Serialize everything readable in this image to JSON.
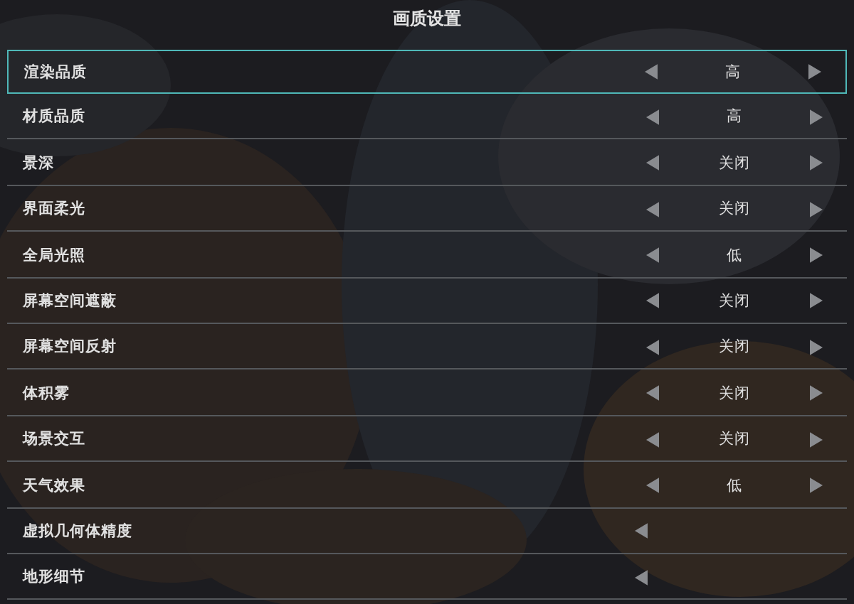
{
  "title": "画质设置",
  "settings": [
    {
      "label": "渲染品质",
      "value": "高",
      "selected": true
    },
    {
      "label": "材质品质",
      "value": "高",
      "selected": false
    },
    {
      "label": "景深",
      "value": "关闭",
      "selected": false
    },
    {
      "label": "界面柔光",
      "value": "关闭",
      "selected": false
    },
    {
      "label": "全局光照",
      "value": "低",
      "selected": false
    },
    {
      "label": "屏幕空间遮蔽",
      "value": "关闭",
      "selected": false
    },
    {
      "label": "屏幕空间反射",
      "value": "关闭",
      "selected": false
    },
    {
      "label": "体积雾",
      "value": "关闭",
      "selected": false
    },
    {
      "label": "场景交互",
      "value": "关闭",
      "selected": false
    },
    {
      "label": "天气效果",
      "value": "低",
      "selected": false
    },
    {
      "label": "虚拟几何体精度",
      "selected": false
    },
    {
      "label": "地形细节",
      "selected": false
    }
  ]
}
